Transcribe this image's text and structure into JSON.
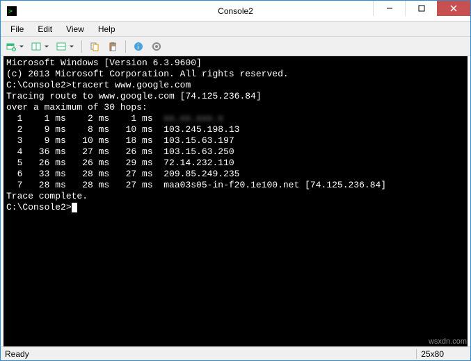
{
  "window": {
    "title": "Console2"
  },
  "menu": {
    "items": [
      "File",
      "Edit",
      "View",
      "Help"
    ]
  },
  "toolbar": {
    "buttons": [
      {
        "name": "new-tab-dropdown-icon",
        "glyph": "tab-new"
      },
      {
        "name": "split-h-dropdown-icon",
        "glyph": "split-h"
      },
      {
        "name": "split-v-dropdown-icon",
        "glyph": "split-v"
      },
      {
        "sep": true
      },
      {
        "name": "copy-icon",
        "glyph": "copy"
      },
      {
        "name": "paste-icon",
        "glyph": "paste"
      },
      {
        "sep": true
      },
      {
        "name": "info-icon",
        "glyph": "info"
      },
      {
        "name": "settings-icon",
        "glyph": "gear"
      }
    ]
  },
  "terminal": {
    "banner1": "Microsoft Windows [Version 6.3.9600]",
    "banner2": "(c) 2013 Microsoft Corporation. All rights reserved.",
    "prompt1": "C:\\Console2>",
    "cmd1": "tracert www.google.com",
    "trace_head1": "Tracing route to www.google.com [74.125.236.84]",
    "trace_head2": "over a maximum of 30 hops:",
    "hops": [
      {
        "n": "1",
        "a": "1 ms",
        "b": "2 ms",
        "c": "1 ms",
        "host": "",
        "blurred": true
      },
      {
        "n": "2",
        "a": "9 ms",
        "b": "8 ms",
        "c": "10 ms",
        "host": "103.245.198.13"
      },
      {
        "n": "3",
        "a": "9 ms",
        "b": "10 ms",
        "c": "18 ms",
        "host": "103.15.63.197"
      },
      {
        "n": "4",
        "a": "36 ms",
        "b": "27 ms",
        "c": "26 ms",
        "host": "103.15.63.250"
      },
      {
        "n": "5",
        "a": "26 ms",
        "b": "26 ms",
        "c": "29 ms",
        "host": "72.14.232.110"
      },
      {
        "n": "6",
        "a": "33 ms",
        "b": "28 ms",
        "c": "27 ms",
        "host": "209.85.249.235"
      },
      {
        "n": "7",
        "a": "28 ms",
        "b": "28 ms",
        "c": "27 ms",
        "host": "maa03s05-in-f20.1e100.net [74.125.236.84]"
      }
    ],
    "complete": "Trace complete.",
    "prompt2": "C:\\Console2>"
  },
  "status": {
    "left": "Ready",
    "size": "25x80"
  },
  "watermark": "wsxdn.com"
}
